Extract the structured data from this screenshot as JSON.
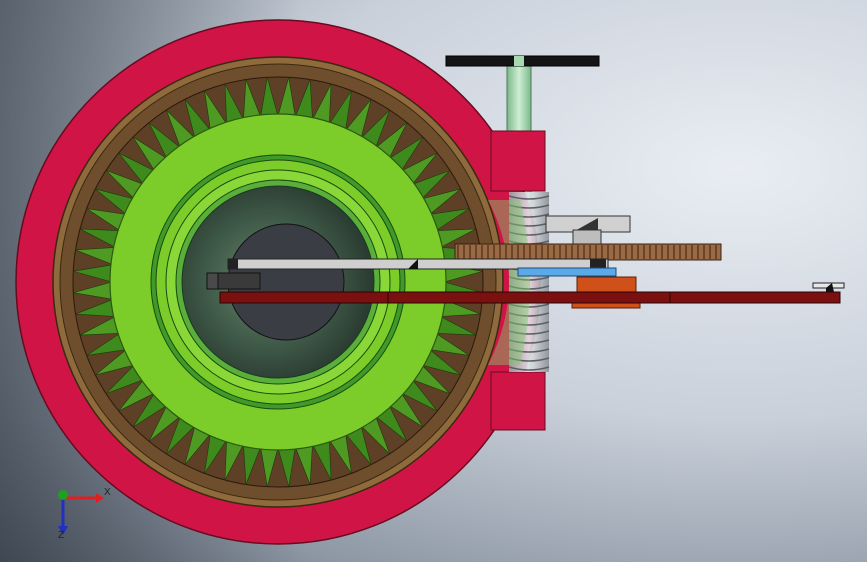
{
  "scene": {
    "description_colors": {
      "outer_ring": "#d01446",
      "outer_ring_edge": "#8a0a2a",
      "bronze_ring": "#8a6a3a",
      "brown_gear": "#6a4a2c",
      "green_teeth": "#3f8a1c",
      "green_gear": "#7ccc2a",
      "inner_green": "#4f9a3a",
      "hub_dark": "#3a3f44",
      "shaft_green": "#a8d8b0",
      "block_red": "#d01446",
      "rack_brown": "#8a5a3a",
      "rod_darkred": "#7a1010",
      "plate_orange": "#d0501a",
      "plate_gray": "#c8c8c8",
      "blue_part": "#4aa0e0"
    }
  },
  "triad": {
    "x_label": "X",
    "z_label": "Z",
    "x_color": "#e02020",
    "y_color": "#20a020",
    "z_color": "#2030c0"
  }
}
